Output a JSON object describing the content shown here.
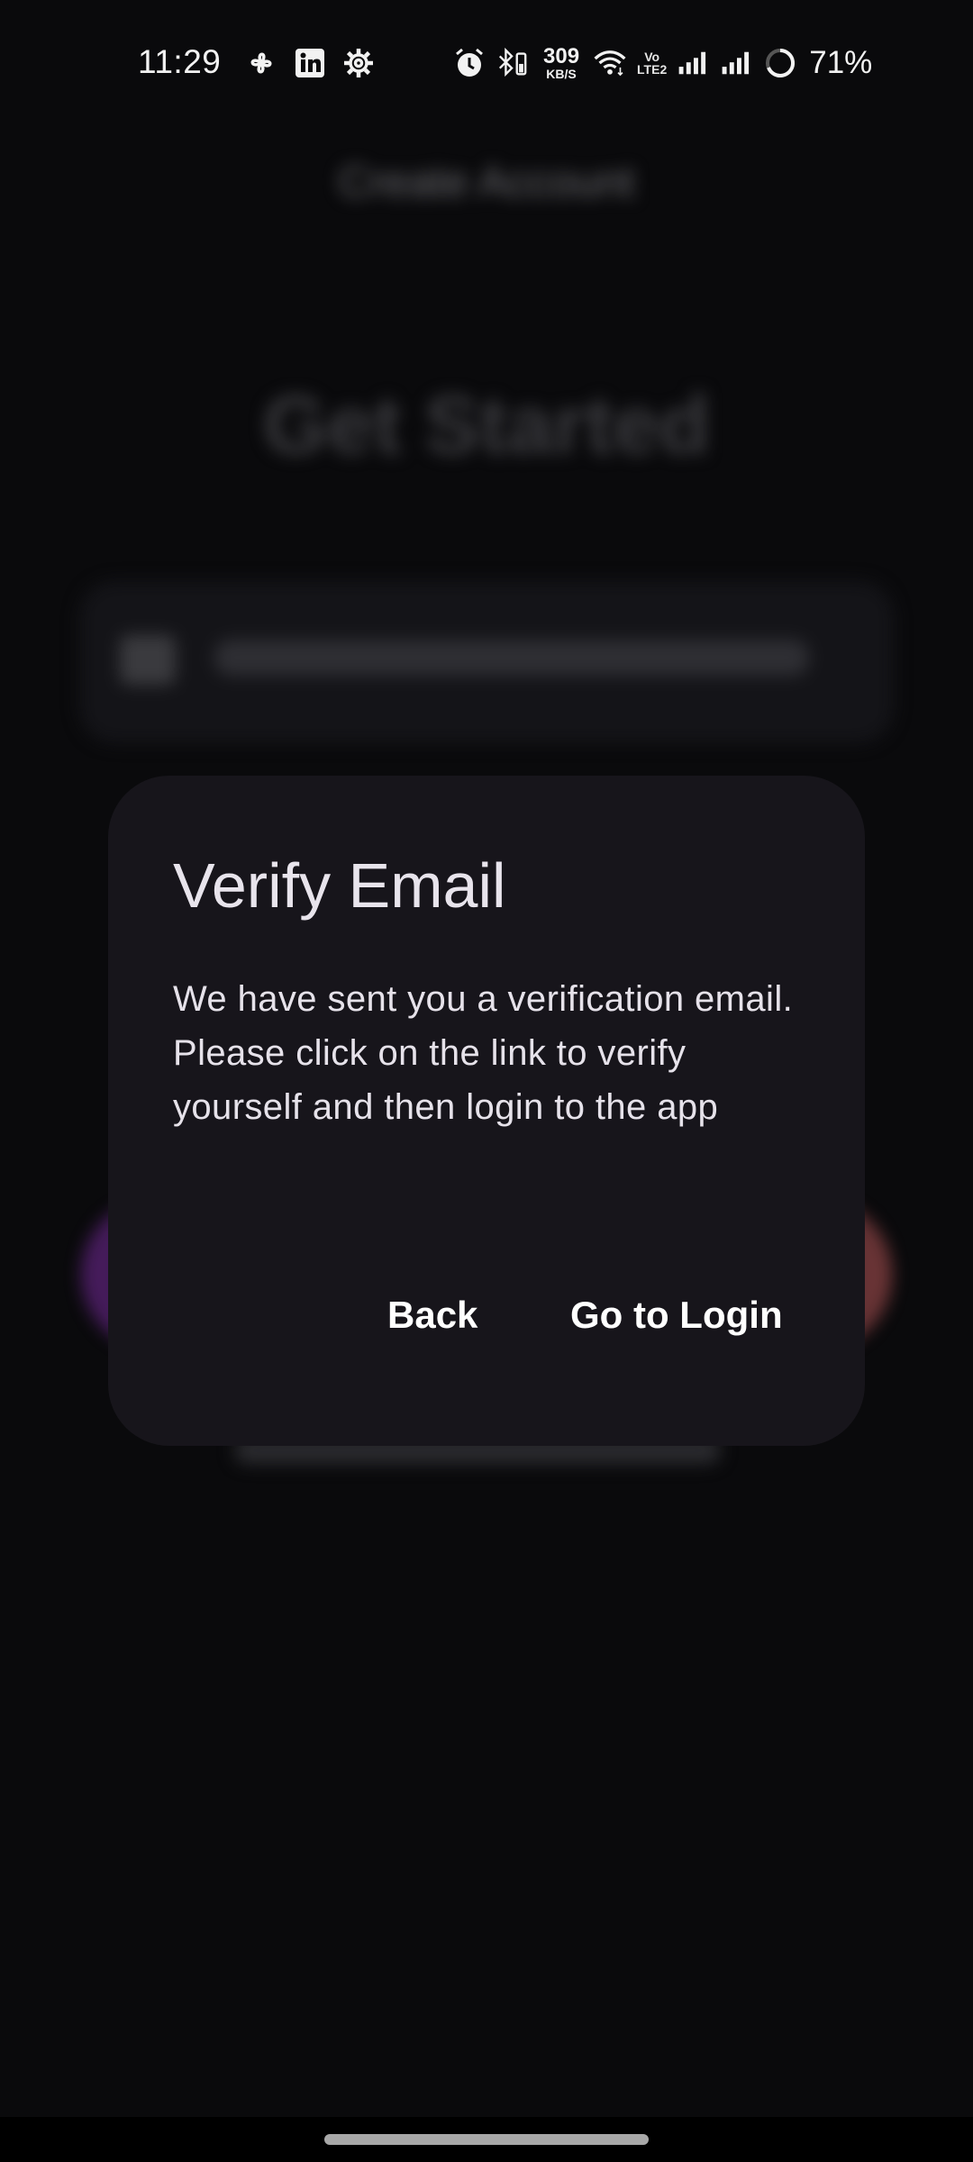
{
  "status_bar": {
    "time": "11:29",
    "net_speed_value": "309",
    "net_speed_unit": "KB/S",
    "volte_line1": "Vo",
    "volte_line2": "LTE2",
    "battery": "71%"
  },
  "background": {
    "screen_title": "Create Account",
    "headline": "Get Started"
  },
  "dialog": {
    "title": "Verify Email",
    "message": "We have sent you a verification email. Please click on the link to verify yourself and then login to the app",
    "back_label": "Back",
    "login_label": "Go to Login"
  },
  "colors": {
    "background": "#0a0a0c",
    "dialog": "#17151b",
    "text": "#e8e4ec"
  }
}
